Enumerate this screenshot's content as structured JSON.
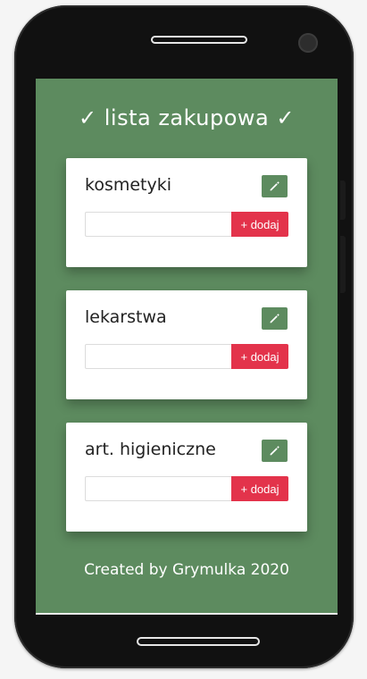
{
  "app": {
    "title": "✓ lista zakupowa ✓"
  },
  "lists": [
    {
      "title": "kosmetyki",
      "input_value": "",
      "add_label": "+ dodaj",
      "edit_icon": "pencil-icon"
    },
    {
      "title": "lekarstwa",
      "input_value": "",
      "add_label": "+ dodaj",
      "edit_icon": "pencil-icon"
    },
    {
      "title": "art. higieniczne",
      "input_value": "",
      "add_label": "+ dodaj",
      "edit_icon": "pencil-icon"
    }
  ],
  "footer": {
    "text": "Created by Grymulka 2020"
  },
  "colors": {
    "background": "#5d8b5f",
    "accent_red": "#e3334b",
    "card": "#ffffff"
  }
}
